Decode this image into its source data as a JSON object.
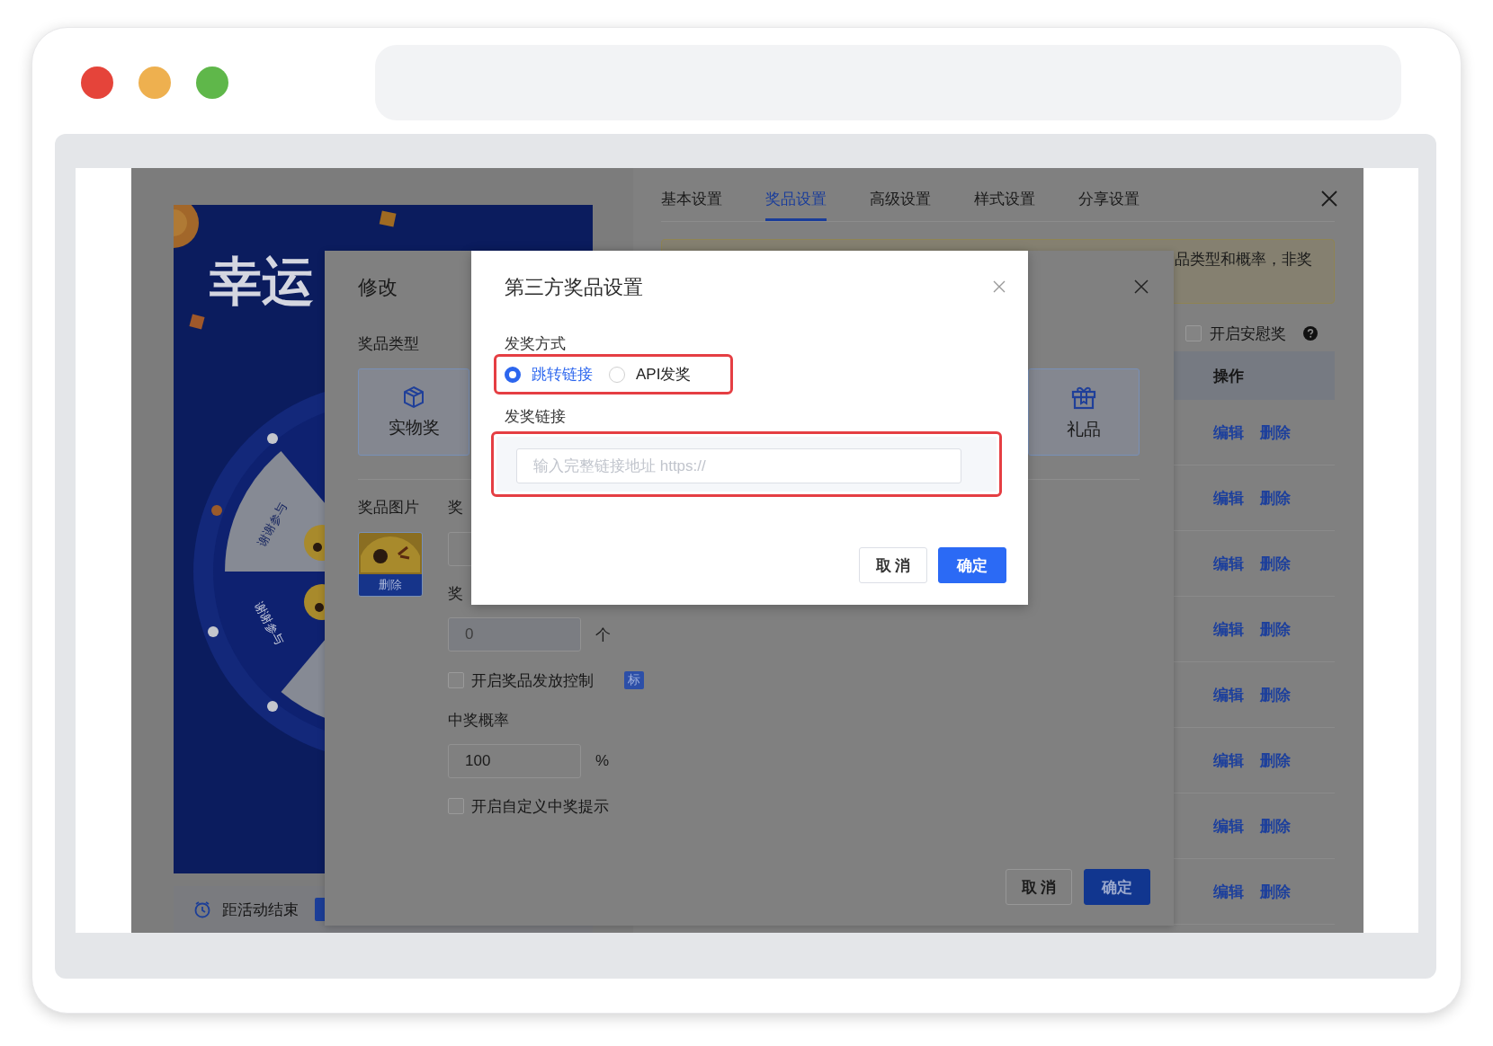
{
  "browser": {
    "lights": [
      {
        "color": "#e5443a"
      },
      {
        "color": "#eeb04f"
      },
      {
        "color": "#5fb74a"
      }
    ]
  },
  "poster": {
    "title": "幸运",
    "wheel_labels": [
      "谢谢参与",
      "谢谢参与"
    ],
    "countdown_label": "距活动结束"
  },
  "drawer": {
    "tabs": [
      {
        "label": "基本设置",
        "selected": false
      },
      {
        "label": "奖品设置",
        "selected": true
      },
      {
        "label": "高级设置",
        "selected": false
      },
      {
        "label": "样式设置",
        "selected": false
      },
      {
        "label": "分享设置",
        "selected": false
      }
    ],
    "notice": "品类型和概率，非奖",
    "consolation": {
      "label": "开启安慰奖",
      "checked": false
    },
    "table": {
      "columns": [
        "操作"
      ],
      "rows": [
        {
          "actions": [
            "编辑",
            "删除"
          ]
        },
        {
          "actions": [
            "编辑",
            "删除"
          ]
        },
        {
          "actions": [
            "编辑",
            "删除"
          ]
        },
        {
          "actions": [
            "编辑",
            "删除"
          ]
        },
        {
          "actions": [
            "编辑",
            "删除"
          ]
        },
        {
          "actions": [
            "编辑",
            "删除"
          ]
        },
        {
          "actions": [
            "编辑",
            "删除"
          ]
        },
        {
          "actions": [
            "编辑",
            "删除"
          ]
        }
      ]
    }
  },
  "edit_modal": {
    "title": "修改",
    "type_label": "奖品类型",
    "types": [
      {
        "label": "实物奖",
        "kind": "box"
      },
      {
        "label": "礼品",
        "kind": "gift"
      }
    ],
    "image_label": "奖品图片",
    "image_delete": "删除",
    "cut_labels": [
      "奖",
      "奖"
    ],
    "stock": {
      "value": "0",
      "disabled": true,
      "unit": "个"
    },
    "release_control": {
      "label": "开启奖品发放控制",
      "checked": false,
      "badge": "标"
    },
    "probability": {
      "label": "中奖概率",
      "value": "100",
      "unit": "%"
    },
    "custom_tip": {
      "label": "开启自定义中奖提示",
      "checked": false
    },
    "buttons": [
      {
        "label": "取 消",
        "kind": "default"
      },
      {
        "label": "确定",
        "kind": "primary"
      }
    ]
  },
  "dialog": {
    "title": "第三方奖品设置",
    "method_label": "发奖方式",
    "methods": [
      {
        "label": "跳转链接",
        "selected": true
      },
      {
        "label": "API发奖",
        "selected": false
      }
    ],
    "method_highlighted": true,
    "link_label": "发奖链接",
    "link": {
      "placeholder": "输入完整链接地址 https://",
      "highlighted": true
    },
    "buttons": [
      {
        "label": "取 消",
        "kind": "default"
      },
      {
        "label": "确定",
        "kind": "primary"
      }
    ]
  }
}
